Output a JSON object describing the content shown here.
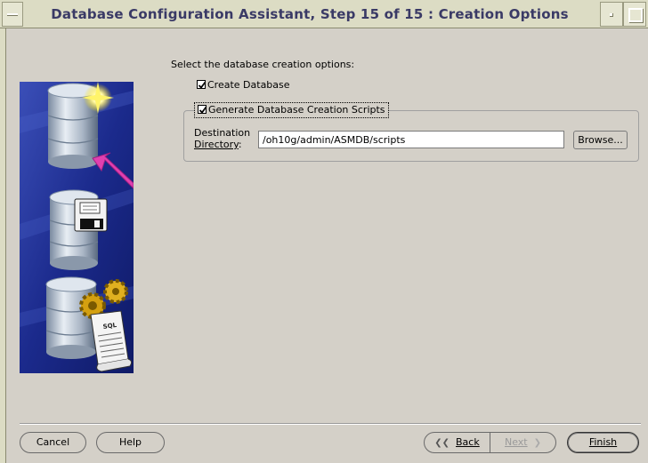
{
  "window": {
    "title": "Database Configuration Assistant, Step 15 of 15 : Creation Options"
  },
  "main": {
    "instruction": "Select the database creation options:",
    "create_database": {
      "label": "Create Database",
      "checked": true
    },
    "generate_scripts": {
      "label": "Generate Database Creation Scripts",
      "checked": true
    },
    "destination": {
      "label_line1": "Destination",
      "label_line2_prefix": "Directory",
      "label_line2_suffix": ":",
      "value": "/oh10g/admin/ASMDB/scripts",
      "browse_label": "Browse..."
    }
  },
  "buttons": {
    "cancel": "Cancel",
    "help": "Help",
    "back": "Back",
    "next": "Next",
    "finish": "Finish"
  },
  "icons": {
    "banner": "database-creation-illustration",
    "check": "check-icon",
    "back_arrow": "chevron-left-icon",
    "next_arrow": "chevron-right-icon"
  },
  "colors": {
    "title_text": "#3a3a66",
    "background": "#d4d0c8",
    "titlebar": "#dcdcc4",
    "banner_bg": "#1a2a8a",
    "accent_arrow": "#e040b0"
  }
}
